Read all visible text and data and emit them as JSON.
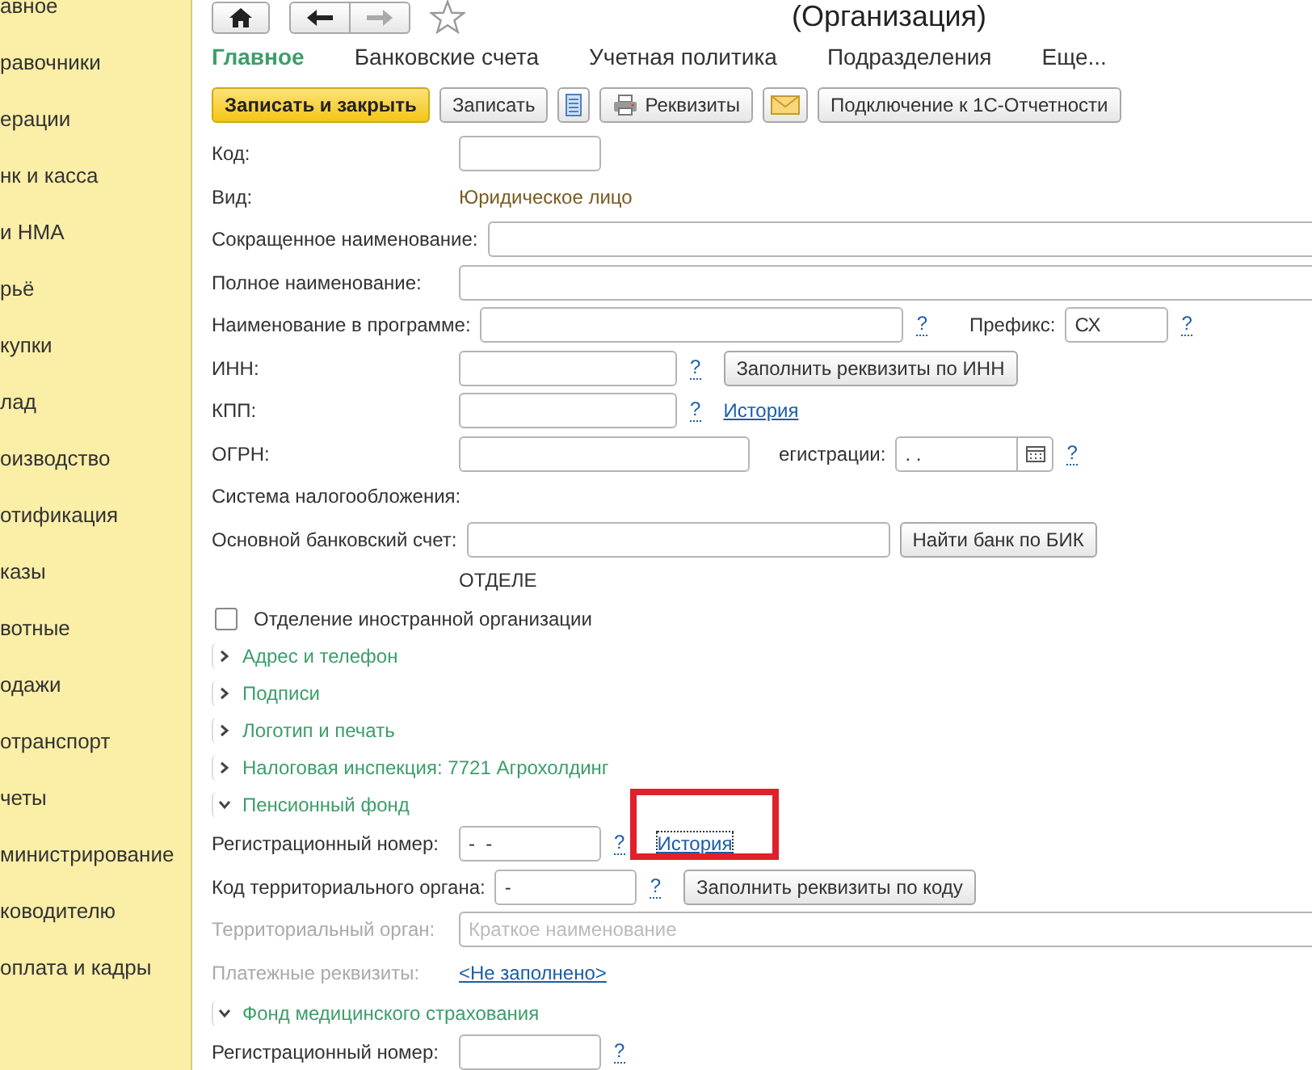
{
  "sidebar": {
    "items": [
      {
        "label": "авное"
      },
      {
        "label": "равочники"
      },
      {
        "label": "ерации"
      },
      {
        "label": "нк и касса"
      },
      {
        "label": "и НМА"
      },
      {
        "label": "рьё"
      },
      {
        "label": "купки"
      },
      {
        "label": "лад"
      },
      {
        "label": "оизводство"
      },
      {
        "label": "отификация"
      },
      {
        "label": "казы"
      },
      {
        "label": "вотные"
      },
      {
        "label": "одажи"
      },
      {
        "label": "отранспорт"
      },
      {
        "label": "четы"
      },
      {
        "label": "министрирование"
      },
      {
        "label": "ководителю"
      },
      {
        "label": "оплата и кадры"
      }
    ]
  },
  "header": {
    "title": "(Организация)"
  },
  "tabs": [
    {
      "label": "Главное",
      "selected": true
    },
    {
      "label": "Банковские счета",
      "selected": false
    },
    {
      "label": "Учетная политика",
      "selected": false
    },
    {
      "label": "Подразделения",
      "selected": false
    },
    {
      "label": "Еще...",
      "selected": false
    }
  ],
  "toolbar": [
    {
      "kind": "primary",
      "label": "Записать и закрыть"
    },
    {
      "kind": "plain",
      "label": "Записать"
    },
    {
      "kind": "list"
    },
    {
      "kind": "print",
      "label": "Реквизиты"
    },
    {
      "kind": "mail"
    },
    {
      "kind": "plain",
      "label": "Подключение к 1С-Отчетности"
    }
  ],
  "form": {
    "rows": [
      {
        "kind": "field",
        "label": "Код:",
        "parts": [
          {
            "kind": "input"
          }
        ]
      },
      {
        "kind": "field",
        "label": "Вид:",
        "parts": [
          {
            "kind": "value",
            "text": "Юридическое лицо"
          }
        ]
      },
      {
        "kind": "field",
        "label": "Сокращенное наименование:",
        "parts": [
          {
            "kind": "input-full"
          }
        ]
      },
      {
        "kind": "field",
        "label": "Полное наименование:",
        "parts": [
          {
            "kind": "input-full"
          }
        ]
      },
      {
        "kind": "field",
        "label": "Наименование в программе:",
        "parts": [
          {
            "kind": "input-long"
          },
          {
            "kind": "help",
            "text": "?"
          },
          {
            "kind": "caption",
            "text": "Префикс:"
          },
          {
            "kind": "input-small",
            "value": "СХ"
          },
          {
            "kind": "help",
            "text": "?"
          }
        ]
      },
      {
        "kind": "field",
        "label": "ИНН:",
        "parts": [
          {
            "kind": "input-mid"
          },
          {
            "kind": "help",
            "text": "?"
          },
          {
            "kind": "button",
            "text": "Заполнить реквизиты по ИНН"
          }
        ]
      },
      {
        "kind": "field",
        "label": "КПП:",
        "parts": [
          {
            "kind": "input-mid"
          },
          {
            "kind": "help",
            "text": "?"
          },
          {
            "kind": "link",
            "text": "История",
            "highlighted": false
          }
        ]
      },
      {
        "kind": "field",
        "label": "ОГРН:",
        "parts": [
          {
            "kind": "input-wide"
          },
          {
            "kind": "caption",
            "text": "егистрации:"
          },
          {
            "kind": "date",
            "value": ". ."
          },
          {
            "kind": "help",
            "text": "?"
          }
        ]
      },
      {
        "kind": "field",
        "label": "Система налогообложения:"
      },
      {
        "kind": "field",
        "label": "Основной банковский счет:",
        "parts": [
          {
            "kind": "input-long"
          },
          {
            "kind": "button",
            "text": "Найти банк по БИК"
          }
        ]
      },
      {
        "kind": "note",
        "text": "ОТДЕЛЕ"
      },
      {
        "kind": "checkbox",
        "label": "Отделение иностранной организации",
        "checked": false
      },
      {
        "kind": "group",
        "label": "Адрес и телефон",
        "expanded": false
      },
      {
        "kind": "group",
        "label": "Подписи",
        "expanded": false
      },
      {
        "kind": "group",
        "label": "Логотип и печать",
        "expanded": false
      },
      {
        "kind": "group",
        "label": "Налоговая инспекция: 7721 Агрохолдинг",
        "expanded": false
      },
      {
        "kind": "group",
        "label": "Пенсионный фонд",
        "expanded": true
      },
      {
        "kind": "field",
        "label": "Регистрационный номер:",
        "parts": [
          {
            "kind": "input",
            "value": "-  -"
          },
          {
            "kind": "help",
            "text": "?"
          },
          {
            "kind": "link",
            "text": "История",
            "highlighted": true
          }
        ]
      },
      {
        "kind": "field",
        "label": "Код территориального органа:",
        "parts": [
          {
            "kind": "input",
            "value": "-"
          },
          {
            "kind": "help",
            "text": "?"
          },
          {
            "kind": "button",
            "text": "Заполнить реквизиты по коду"
          }
        ]
      },
      {
        "kind": "field",
        "label": "Территориальный орган:",
        "disabled": true,
        "parts": [
          {
            "kind": "input-full",
            "placeholder": "Краткое наименование"
          }
        ]
      },
      {
        "kind": "field",
        "label": "Платежные реквизиты:",
        "disabled": true,
        "parts": [
          {
            "kind": "link",
            "text": "<Не заполнено>",
            "highlighted": false
          }
        ]
      },
      {
        "kind": "group",
        "label": "Фонд медицинского страхования",
        "expanded": true
      },
      {
        "kind": "field",
        "label": "Регистрационный номер:",
        "parts": [
          {
            "kind": "input"
          },
          {
            "kind": "help",
            "text": "?"
          }
        ]
      }
    ]
  }
}
